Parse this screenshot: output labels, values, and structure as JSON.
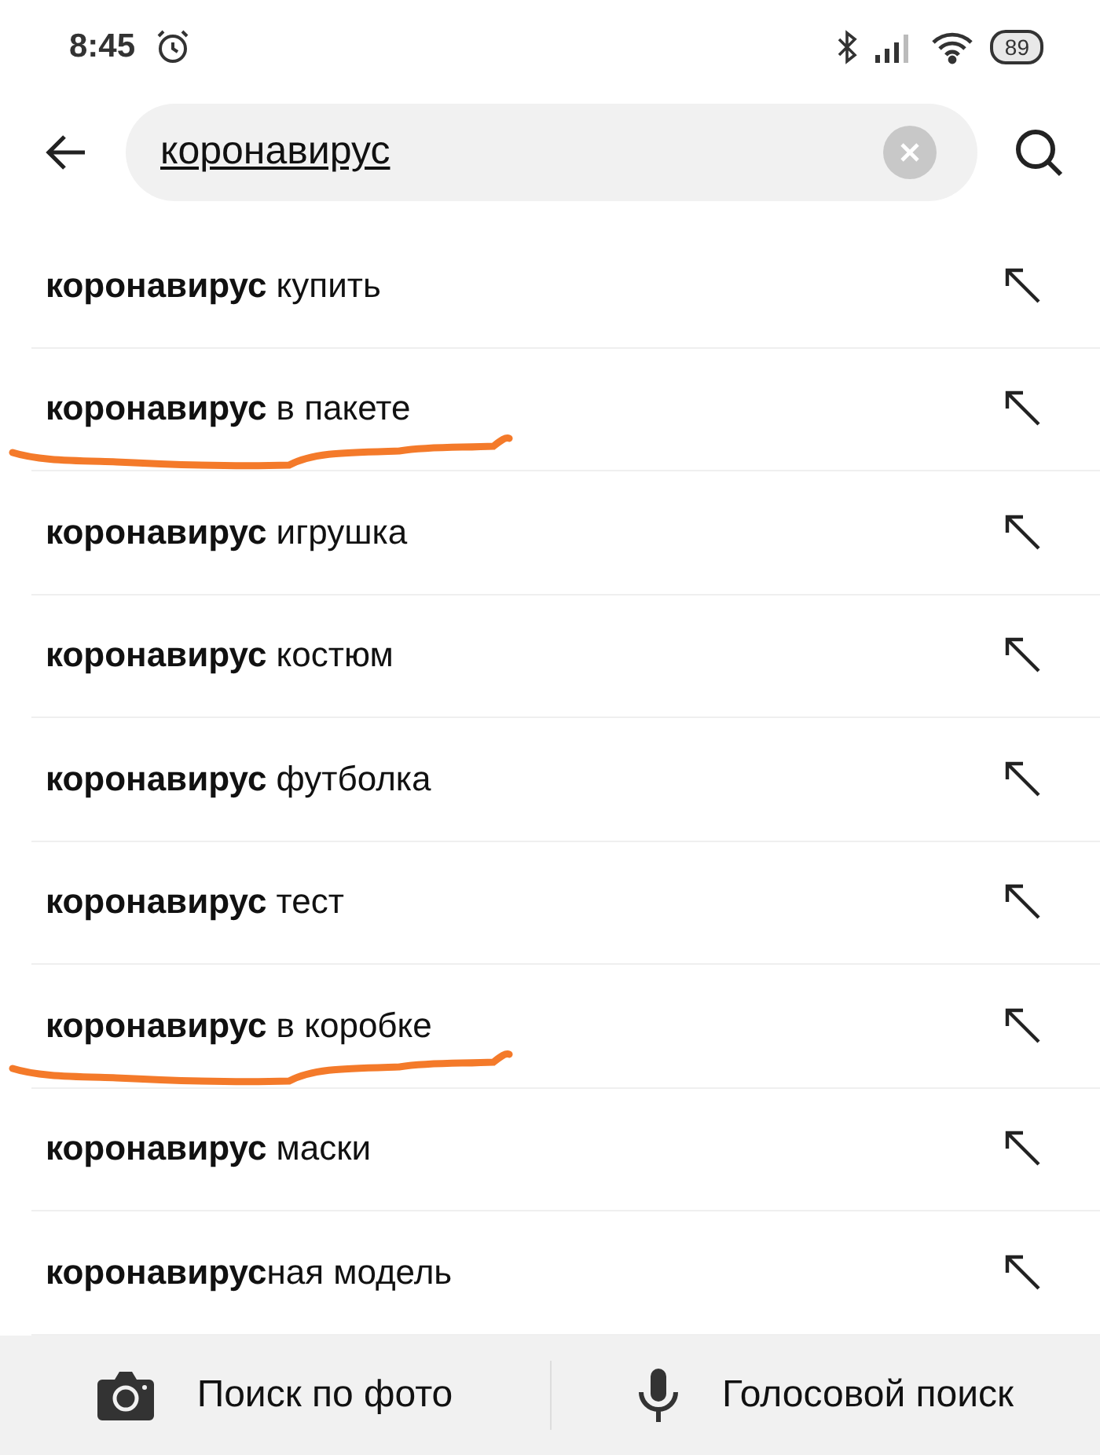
{
  "status_bar": {
    "time": "8:45",
    "battery": "89"
  },
  "search": {
    "value": "коронавирус"
  },
  "suggestions": [
    {
      "text": "**коронавирус** купить",
      "marked": false
    },
    {
      "text": "**коронавирус** в пакете",
      "marked": true
    },
    {
      "text": "**коронавирус** игрушка",
      "marked": false
    },
    {
      "text": "**коронавирус** костюм",
      "marked": false
    },
    {
      "text": "**коронавирус** футболка",
      "marked": false
    },
    {
      "text": "**коронавирус** тест",
      "marked": false
    },
    {
      "text": "**коронавирус** в коробке",
      "marked": true
    },
    {
      "text": "**коронавирус** маски",
      "marked": false
    },
    {
      "text": "**коронавирус**ная модель",
      "marked": false
    }
  ],
  "bottom_bar": {
    "photo_search": "Поиск по фото",
    "voice_search": "Голосовой поиск"
  }
}
